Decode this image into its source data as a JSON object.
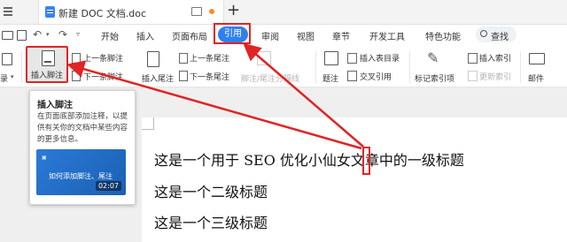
{
  "titlebar": {
    "doc_title": "新建 DOC 文档.doc",
    "new_tab": "+"
  },
  "menu": {
    "items": [
      "开始",
      "插入",
      "页面布局",
      "引用",
      "审阅",
      "视图",
      "章节",
      "开发工具",
      "特色功能"
    ],
    "active": "引用",
    "search": "查找"
  },
  "ribbon": {
    "left_partial": "录",
    "insert_footnote": "插入脚注",
    "prev_footnote": "上一条脚注",
    "next_footnote": "下一条脚注",
    "insert_endnote": "插入尾注",
    "prev_endnote": "上一条尾注",
    "next_endnote": "下一条尾注",
    "footnote_separator": "脚注/尾注分隔线",
    "caption": "题注",
    "insert_table_of_figures": "插入表目录",
    "cross_reference": "交叉引用",
    "mark_index_entry": "标记索引项",
    "insert_index": "插入索引",
    "update_index": "更新索引",
    "mail": "邮件"
  },
  "tooltip": {
    "title": "插入脚注",
    "description": "在页面底部添加注释，以提供有关你的文档中某些内容的更多信息。",
    "video_title": "如何添加脚注、尾注",
    "video_duration": "02:07"
  },
  "document": {
    "lines": [
      "这是一个用于 SEO 优化小仙女文章中的一级标题",
      "这是一个二级标题",
      "这是一个三级标题"
    ]
  },
  "colors": {
    "accent": "#2f80ed",
    "highlight": "#e02424"
  }
}
